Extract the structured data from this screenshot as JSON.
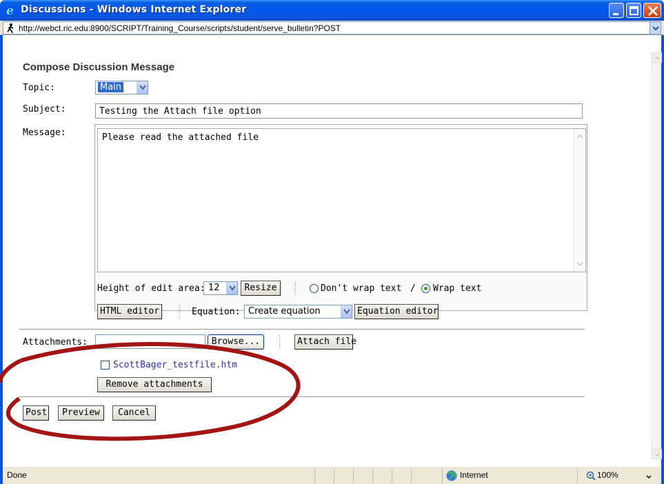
{
  "window": {
    "title": "Discussions - Windows Internet Explorer",
    "address": "http://webct.ric.edu:8900/SCRIPT/Training_Course/scripts/student/serve_bulletin?POST"
  },
  "form": {
    "heading": "Compose Discussion Message",
    "topic_label": "Topic:",
    "topic_value": "Main",
    "subject_label": "Subject:",
    "subject_value": "Testing the Attach file option",
    "message_label": "Message:",
    "message_value": "Please read the attached file",
    "height_label": "Height of edit area:",
    "height_value": "12",
    "resize_label": "Resize",
    "no_wrap_label": "Don't wrap text",
    "wrap_sep": "/",
    "wrap_label": "Wrap text",
    "html_editor_label": "HTML editor",
    "equation_label": "Equation:",
    "equation_value": "Create equation",
    "equation_editor_label": "Equation editor",
    "attachments_label": "Attachments:",
    "browse_label": "Browse...",
    "attach_file_label": "Attach file",
    "attached_file": "ScottBager_testfile.htm",
    "remove_attachments_label": "Remove attachments",
    "post_label": "Post",
    "preview_label": "Preview",
    "cancel_label": "Cancel"
  },
  "status": {
    "text": "Done",
    "zone": "Internet",
    "zoom": "100%"
  },
  "colors": {
    "titlebar": "#0058ee",
    "link": "#333399",
    "annotation": "#a31515"
  }
}
